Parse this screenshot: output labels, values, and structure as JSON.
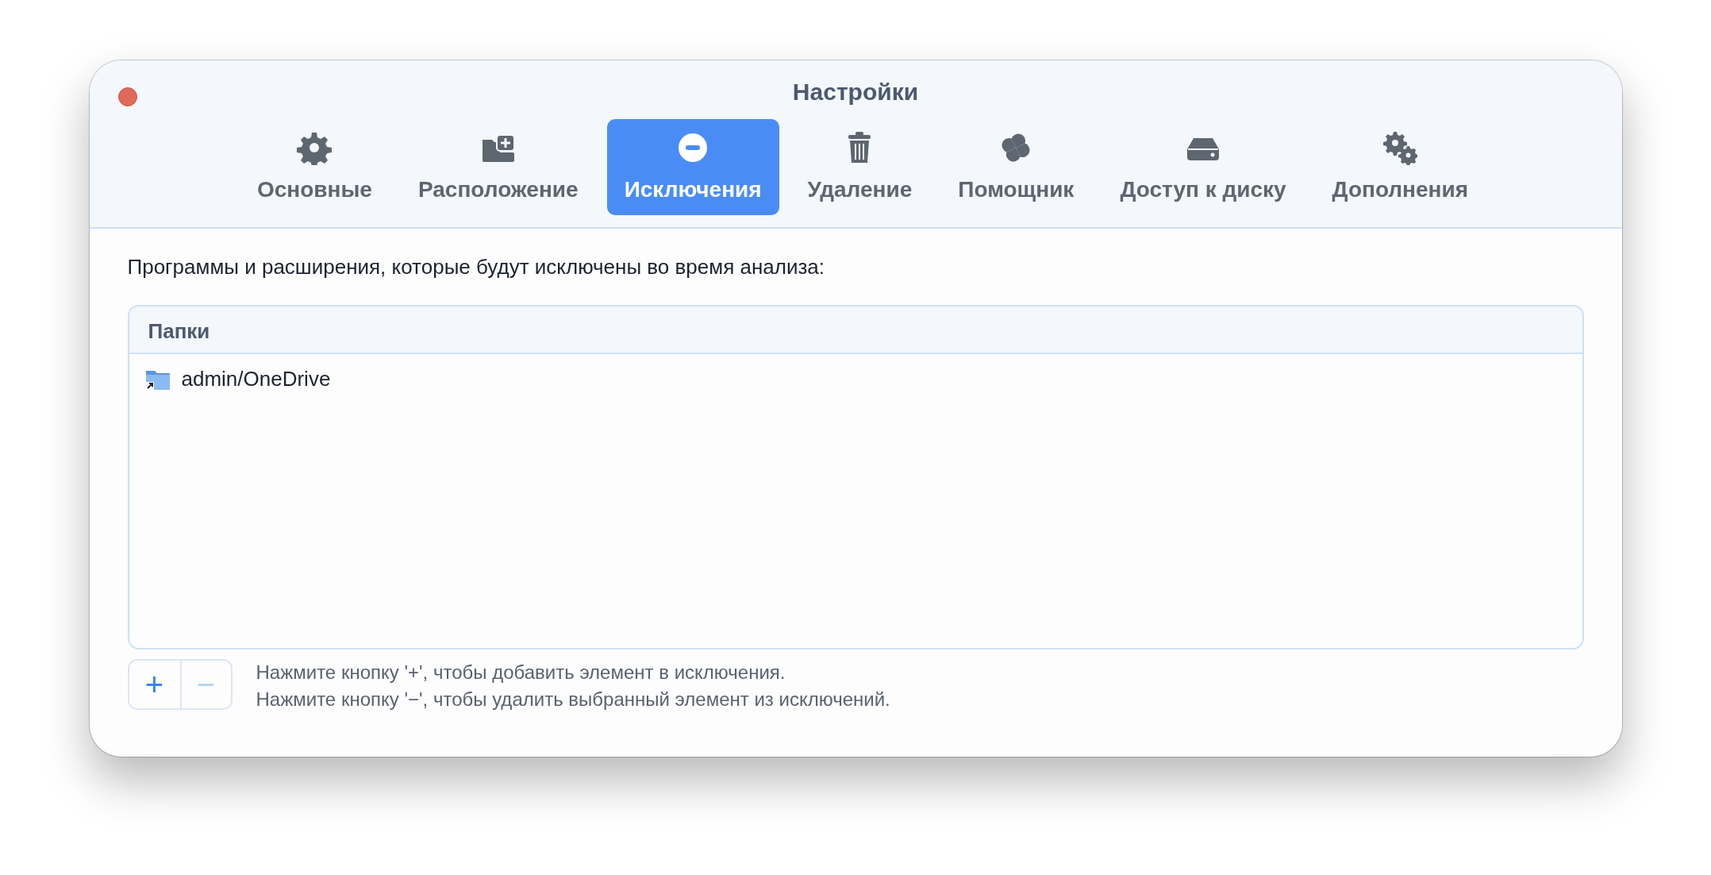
{
  "window": {
    "title": "Настройки"
  },
  "tabs": [
    {
      "label": "Основные",
      "selected": false
    },
    {
      "label": "Расположение",
      "selected": false
    },
    {
      "label": "Исключения",
      "selected": true
    },
    {
      "label": "Удаление",
      "selected": false
    },
    {
      "label": "Помощник",
      "selected": false
    },
    {
      "label": "Доступ к диску",
      "selected": false
    },
    {
      "label": "Дополнения",
      "selected": false
    }
  ],
  "description": "Программы и расширения, которые будут исключены во время анализа:",
  "list": {
    "column": "Папки",
    "rows": [
      {
        "path": "admin/OneDrive",
        "selected": false
      }
    ]
  },
  "buttons": [
    {
      "label": "+",
      "disabled": false
    },
    {
      "label": "−",
      "disabled": true
    }
  ],
  "hints": [
    "Нажмите кнопку '+', чтобы добавить элемент в исключения.",
    "Нажмите кнопку '−', чтобы удалить выбранный элемент из исключений."
  ]
}
